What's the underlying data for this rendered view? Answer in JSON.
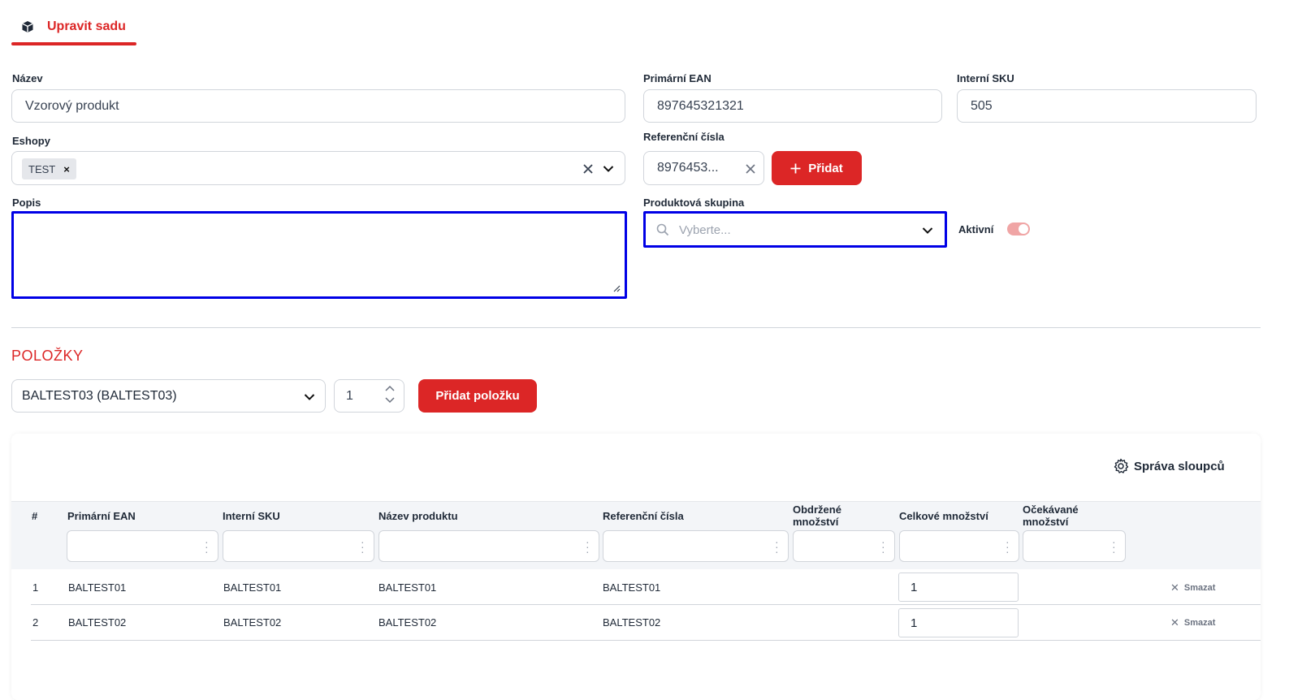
{
  "tab": {
    "label": "Upravit sadu",
    "icon": "box-icon"
  },
  "form": {
    "name": {
      "label": "Název",
      "value": "Vzorový produkt"
    },
    "primary_ean": {
      "label": "Primární EAN",
      "value": "897645321321"
    },
    "internal_sku": {
      "label": "Interní SKU",
      "value": "505"
    },
    "eshops": {
      "label": "Eshopy",
      "chips": [
        "TEST"
      ]
    },
    "reference_numbers": {
      "label": "Referenční čísla",
      "value": "8976453...",
      "add_label": "Přidat"
    },
    "description": {
      "label": "Popis",
      "value": ""
    },
    "product_group": {
      "label": "Produktová skupina",
      "placeholder": "Vyberte..."
    },
    "active": {
      "label": "Aktivní",
      "on": true
    }
  },
  "items_section": {
    "title": "POLOŽKY",
    "selected_product": "BALTEST03 (BALTEST03)",
    "quantity": "1",
    "add_item_label": "Přidat položku"
  },
  "table": {
    "manage_columns_label": "Správa sloupců",
    "headers": {
      "index": "#",
      "primary_ean": "Primární EAN",
      "internal_sku": "Interní SKU",
      "product_name": "Název produktu",
      "reference_numbers": "Referenční čísla",
      "received_qty_1": "Obdržené",
      "received_qty_2": "množství",
      "total_qty": "Celkové množství",
      "expected_qty_1": "Očekávané",
      "expected_qty_2": "množství"
    },
    "rows": [
      {
        "index": "1",
        "primary_ean": "BALTEST01",
        "internal_sku": "BALTEST01",
        "product_name": "BALTEST01",
        "reference_numbers": "BALTEST01",
        "total_qty": "1",
        "delete_label": "Smazat"
      },
      {
        "index": "2",
        "primary_ean": "BALTEST02",
        "internal_sku": "BALTEST02",
        "product_name": "BALTEST02",
        "reference_numbers": "BALTEST02",
        "total_qty": "1",
        "delete_label": "Smazat"
      }
    ]
  },
  "colors": {
    "accent": "#dc2626",
    "focus": "#0000e6",
    "toggle": "#f0a5a5"
  }
}
